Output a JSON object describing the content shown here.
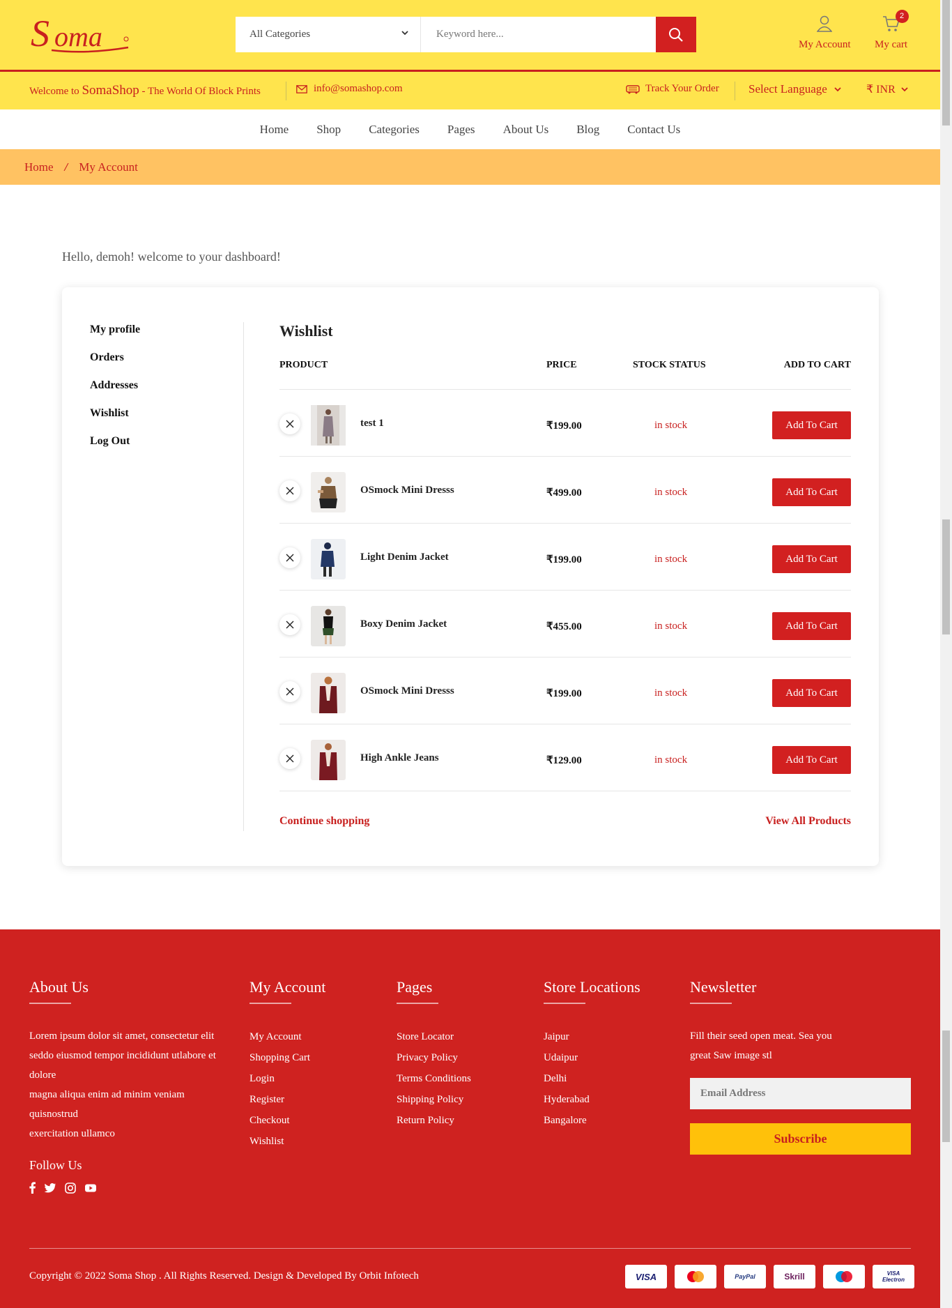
{
  "header": {
    "logo_text": "Soma",
    "category_select": "All Categories",
    "search_placeholder": "Keyword here...",
    "my_account": "My Account",
    "my_cart": "My cart",
    "cart_count": "2"
  },
  "subbar": {
    "welcome_prefix": "Welcome to ",
    "brand": "SomaShop",
    "welcome_suffix": " - The World Of Block Prints",
    "email": "info@somashop.com",
    "track_order": "Track Your Order",
    "language": "Select Language",
    "currency": "₹ INR"
  },
  "nav": {
    "items": [
      "Home",
      "Shop",
      "Categories",
      "Pages",
      "About Us",
      "Blog",
      "Contact Us"
    ]
  },
  "breadcrumb": {
    "home": "Home",
    "current": "My Account"
  },
  "dashboard": {
    "greeting": "Hello, demoh! welcome to your dashboard!",
    "sidebar": [
      "My profile",
      "Orders",
      "Addresses",
      "Wishlist",
      "Log Out"
    ]
  },
  "wishlist": {
    "title": "Wishlist",
    "columns": {
      "product": "PRODUCT",
      "price": "PRICE",
      "stock": "STOCK STATUS",
      "cart": "ADD TO CART"
    },
    "items": [
      {
        "name": "test 1",
        "price": "₹199.00",
        "stock": "in stock",
        "button": "Add To Cart"
      },
      {
        "name": "OSmock Mini Dresss",
        "price": "₹499.00",
        "stock": "in stock",
        "button": "Add To Cart"
      },
      {
        "name": "Light Denim Jacket",
        "price": "₹199.00",
        "stock": "in stock",
        "button": "Add To Cart"
      },
      {
        "name": "Boxy Denim Jacket",
        "price": "₹455.00",
        "stock": "in stock",
        "button": "Add To Cart"
      },
      {
        "name": "OSmock Mini Dresss",
        "price": "₹199.00",
        "stock": "in stock",
        "button": "Add To Cart"
      },
      {
        "name": "High Ankle Jeans",
        "price": "₹129.00",
        "stock": "in stock",
        "button": "Add To Cart"
      }
    ],
    "continue": "Continue shopping",
    "view_all": "View All Products"
  },
  "footer": {
    "about": {
      "title": "About Us",
      "text1": "Lorem ipsum dolor sit amet, consectetur elit seddo eiusmod tempor incididunt utlabore et dolore",
      "text2": "magna aliqua enim ad minim veniam quisnostrud",
      "text3": "exercitation ullamco",
      "follow": "Follow Us"
    },
    "account": {
      "title": "My Account",
      "links": [
        "My Account",
        "Shopping Cart",
        "Login",
        "Register",
        "Checkout",
        "Wishlist"
      ]
    },
    "pages": {
      "title": "Pages",
      "links": [
        "Store Locator",
        "Privacy Policy",
        "Terms Conditions",
        "Shipping Policy",
        "Return Policy"
      ]
    },
    "stores": {
      "title": "Store Locations",
      "links": [
        "Jaipur",
        "Udaipur",
        "Delhi",
        "Hyderabad",
        "Bangalore"
      ]
    },
    "newsletter": {
      "title": "Newsletter",
      "text": "Fill their seed open meat. Sea you great Saw image stl",
      "placeholder": "Email Address",
      "button": "Subscribe"
    },
    "copyright": "Copyright © 2022 Soma Shop . All Rights Reserved. Design & Developed By Orbit Infotech",
    "payments": [
      "VISA",
      "MasterCard",
      "PayPal",
      "Skrill",
      "Maestro",
      "VISA Electron"
    ]
  },
  "colors": {
    "brand_red": "#d22020",
    "header_yellow": "#ffe44d",
    "breadcrumb_orange": "#ffc262",
    "subscribe_yellow": "#ffc10a"
  }
}
